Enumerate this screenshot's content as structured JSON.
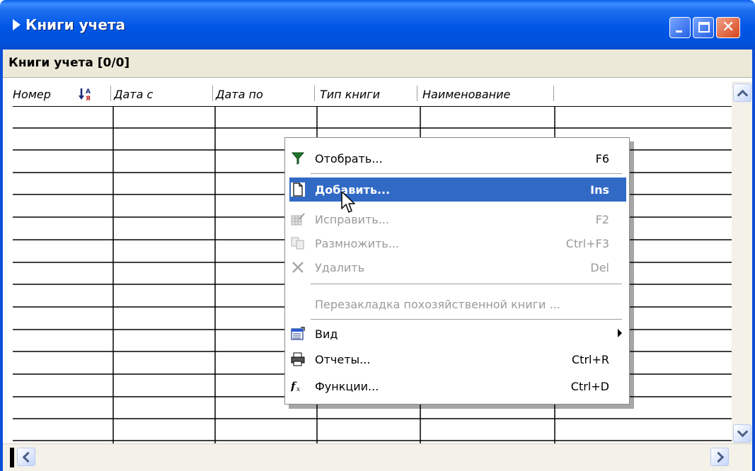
{
  "window": {
    "title": "Книги учета",
    "minimize_icon": "minimize-icon",
    "maximize_icon": "maximize-icon",
    "close_icon": "close-icon",
    "close_glyph": "✕"
  },
  "caption": "Книги учета [0/0]",
  "grid": {
    "columns": [
      "Номер",
      "Дата с",
      "Дата по",
      "Тип книги",
      "Наименование"
    ],
    "sort_icon": "sort-ascending-az-icon",
    "rows": []
  },
  "context_menu": {
    "items": [
      {
        "label": "Отобрать...",
        "shortcut": "F6",
        "icon": "filter-icon",
        "enabled": true
      },
      {
        "label": "Добавить...",
        "shortcut": "Ins",
        "icon": "new-document-icon",
        "enabled": true,
        "selected": true
      },
      {
        "label": "Исправить...",
        "shortcut": "F2",
        "icon": "edit-table-icon",
        "enabled": false
      },
      {
        "label": "Размножить...",
        "shortcut": "Ctrl+F3",
        "icon": "copy-icon",
        "enabled": false
      },
      {
        "label": "Удалить",
        "shortcut": "Del",
        "icon": "delete-icon",
        "enabled": false
      },
      {
        "label": "Перезакладка похозяйственной книги ...",
        "shortcut": "",
        "icon": "",
        "enabled": false
      },
      {
        "label": "Вид",
        "shortcut": "",
        "icon": "view-icon",
        "enabled": true,
        "submenu": true
      },
      {
        "label": "Отчеты...",
        "shortcut": "Ctrl+R",
        "icon": "printer-icon",
        "enabled": true
      },
      {
        "label": "Функции...",
        "shortcut": "Ctrl+D",
        "icon": "function-icon",
        "enabled": true
      }
    ]
  },
  "colors": {
    "titlebar": "#0a55e0",
    "menu_highlight": "#316ac5",
    "disabled_text": "#9a9a9a",
    "caption_background": "#ece9d8"
  }
}
